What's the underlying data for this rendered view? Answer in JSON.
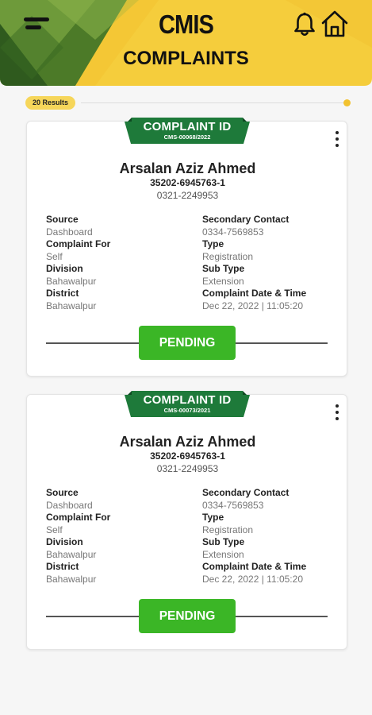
{
  "header": {
    "app_title": "CMIS",
    "page_title": "COMPLAINTS",
    "icons": {
      "menu": "menu-icon",
      "bell": "bell-icon",
      "home": "home-icon"
    }
  },
  "results": {
    "label": "20 Results"
  },
  "labels": {
    "ribbon_title": "COMPLAINT ID",
    "source": "Source",
    "complaint_for": "Complaint For",
    "division": "Division",
    "district": "District",
    "secondary_contact": "Secondary Contact",
    "type": "Type",
    "sub_type": "Sub Type",
    "date_time": "Complaint Date & Time"
  },
  "complaints": [
    {
      "id": "CMS-00068/2022",
      "name": "Arsalan Aziz Ahmed",
      "cnic": "35202-6945763-1",
      "phone": "0321-2249953",
      "source": "Dashboard",
      "complaint_for": "Self",
      "division": "Bahawalpur",
      "district": "Bahawalpur",
      "secondary_contact": "0334-7569853",
      "type": "Registration",
      "sub_type": "Extension",
      "date_time": "Dec 22, 2022 | 11:05:20",
      "status": "PENDING"
    },
    {
      "id": "CMS-00073/2021",
      "name": "Arsalan Aziz Ahmed",
      "cnic": "35202-6945763-1",
      "phone": "0321-2249953",
      "source": "Dashboard",
      "complaint_for": "Self",
      "division": "Bahawalpur",
      "district": "Bahawalpur",
      "secondary_contact": "0334-7569853",
      "type": "Registration",
      "sub_type": "Extension",
      "date_time": "Dec 22, 2022 | 11:05:20",
      "status": "PENDING"
    }
  ],
  "colors": {
    "header_yellow": "#f5cd3c",
    "header_green_dark": "#3f6a24",
    "ribbon_green": "#1e7a3a",
    "status_green": "#3bb626",
    "results_pill": "#f6d65a"
  }
}
